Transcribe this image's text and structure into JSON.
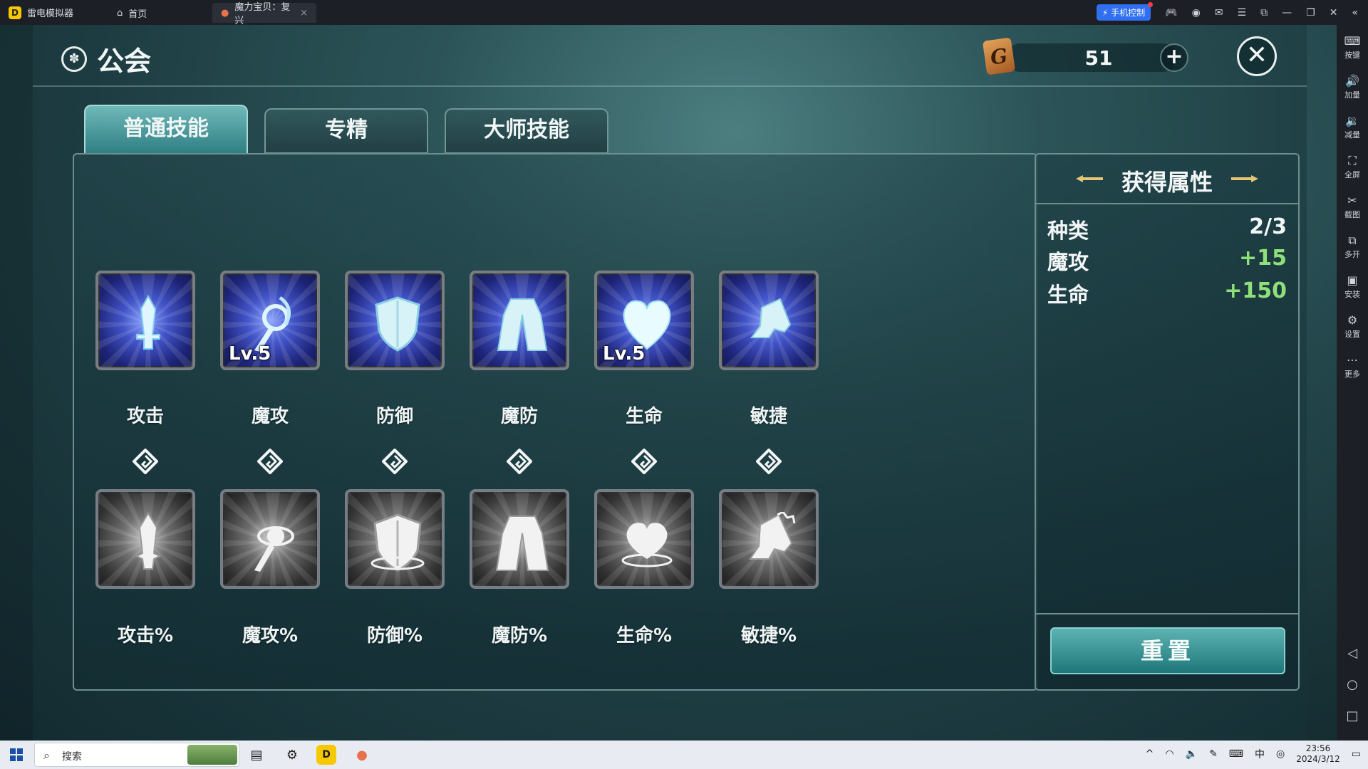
{
  "emulator": {
    "app_name": "雷电模拟器",
    "tabs": [
      {
        "label": "首页",
        "icon": "home-icon"
      },
      {
        "label": "魔力宝贝：复兴",
        "icon": "game-icon",
        "close": "×"
      }
    ],
    "phone_control": "手机控制",
    "sidebar": [
      {
        "label": "按键",
        "icon": "keyboard-icon",
        "glyph": "⌨"
      },
      {
        "label": "加量",
        "icon": "volume-up-icon",
        "glyph": "🔊"
      },
      {
        "label": "减量",
        "icon": "volume-down-icon",
        "glyph": "🔉"
      },
      {
        "label": "全屏",
        "icon": "fullscreen-icon",
        "glyph": "⛶"
      },
      {
        "label": "截图",
        "icon": "scissors-icon",
        "glyph": "✂"
      },
      {
        "label": "多开",
        "icon": "multi-instance-icon",
        "glyph": "⧉"
      },
      {
        "label": "安装",
        "icon": "apk-install-icon",
        "glyph": "▣"
      },
      {
        "label": "设置",
        "icon": "settings-icon",
        "glyph": "⚙"
      },
      {
        "label": "更多",
        "icon": "more-icon",
        "glyph": "⋯"
      }
    ],
    "nav": {
      "back": "◁",
      "home": "○",
      "recent": "□"
    }
  },
  "game": {
    "title": "公会",
    "currency": {
      "symbol": "G",
      "amount": "51",
      "add": "+"
    },
    "close": "✕",
    "tabs": [
      {
        "label": "普通技能",
        "active": true
      },
      {
        "label": "专精",
        "active": false
      },
      {
        "label": "大师技能",
        "active": false
      }
    ],
    "skills_row1": [
      {
        "label": "攻击",
        "level": "",
        "icon": "sword-icon"
      },
      {
        "label": "魔攻",
        "level": "Lv.5",
        "icon": "magic-staff-icon"
      },
      {
        "label": "防御",
        "level": "",
        "icon": "shield-icon"
      },
      {
        "label": "魔防",
        "level": "",
        "icon": "robe-icon"
      },
      {
        "label": "生命",
        "level": "Lv.5",
        "icon": "heart-icon"
      },
      {
        "label": "敏捷",
        "level": "",
        "icon": "boot-icon"
      }
    ],
    "skills_row2": [
      {
        "label": "攻击%",
        "icon": "sword-icon"
      },
      {
        "label": "魔攻%",
        "icon": "magic-staff-icon"
      },
      {
        "label": "防御%",
        "icon": "shield-icon"
      },
      {
        "label": "魔防%",
        "icon": "robe-icon"
      },
      {
        "label": "生命%",
        "icon": "heart-icon"
      },
      {
        "label": "敏捷%",
        "icon": "boot-icon"
      }
    ],
    "attributes": {
      "title": "获得属性",
      "rows": [
        {
          "key": "种类",
          "value": "2/3",
          "color": "#f3f6f6"
        },
        {
          "key": "魔攻",
          "value": "+15",
          "color": "#8fe07a"
        },
        {
          "key": "生命",
          "value": "+150",
          "color": "#8fe07a"
        }
      ],
      "reset": "重置"
    }
  },
  "taskbar": {
    "search": "搜索",
    "time": "23:56",
    "date": "2024/3/12",
    "tray_icons": [
      "chevron-up-icon",
      "wifi-icon",
      "speaker-icon",
      "pen-icon",
      "keyboard-icon",
      "ime-icon",
      "network-icon",
      "notification-icon"
    ]
  }
}
